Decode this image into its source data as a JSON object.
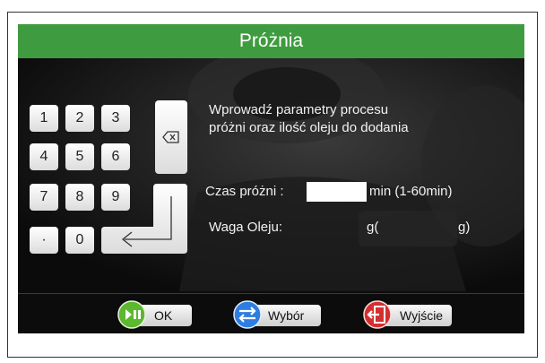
{
  "window": {
    "title": "Próżnia"
  },
  "keypad": {
    "keys": [
      "1",
      "2",
      "3",
      "4",
      "5",
      "6",
      "7",
      "8",
      "9",
      "·",
      "0"
    ],
    "backspace_icon": "backspace-icon",
    "enter_icon": "enter-arrow-icon"
  },
  "message": {
    "line1": "Wprowadź parametry procesu",
    "line2": "próżni oraz ilość oleju do dodania"
  },
  "vacuum_time": {
    "label": "Czas próżni :",
    "value": "",
    "unit": "min (1-60min)"
  },
  "oil_weight": {
    "label": "Waga Oleju:",
    "unit_open": "g(",
    "unit_close": "g)"
  },
  "buttons": {
    "ok": {
      "label": "OK",
      "icon": "play-pause-icon",
      "color": "#5cb82e"
    },
    "select": {
      "label": "Wybór",
      "icon": "swap-arrows-icon",
      "color": "#2f7de0"
    },
    "exit": {
      "label": "Wyjście",
      "icon": "exit-door-icon",
      "color": "#d32f2f"
    }
  },
  "colors": {
    "title_bar": "#3f9b3f",
    "screen_bg": "#0c0c0c"
  }
}
